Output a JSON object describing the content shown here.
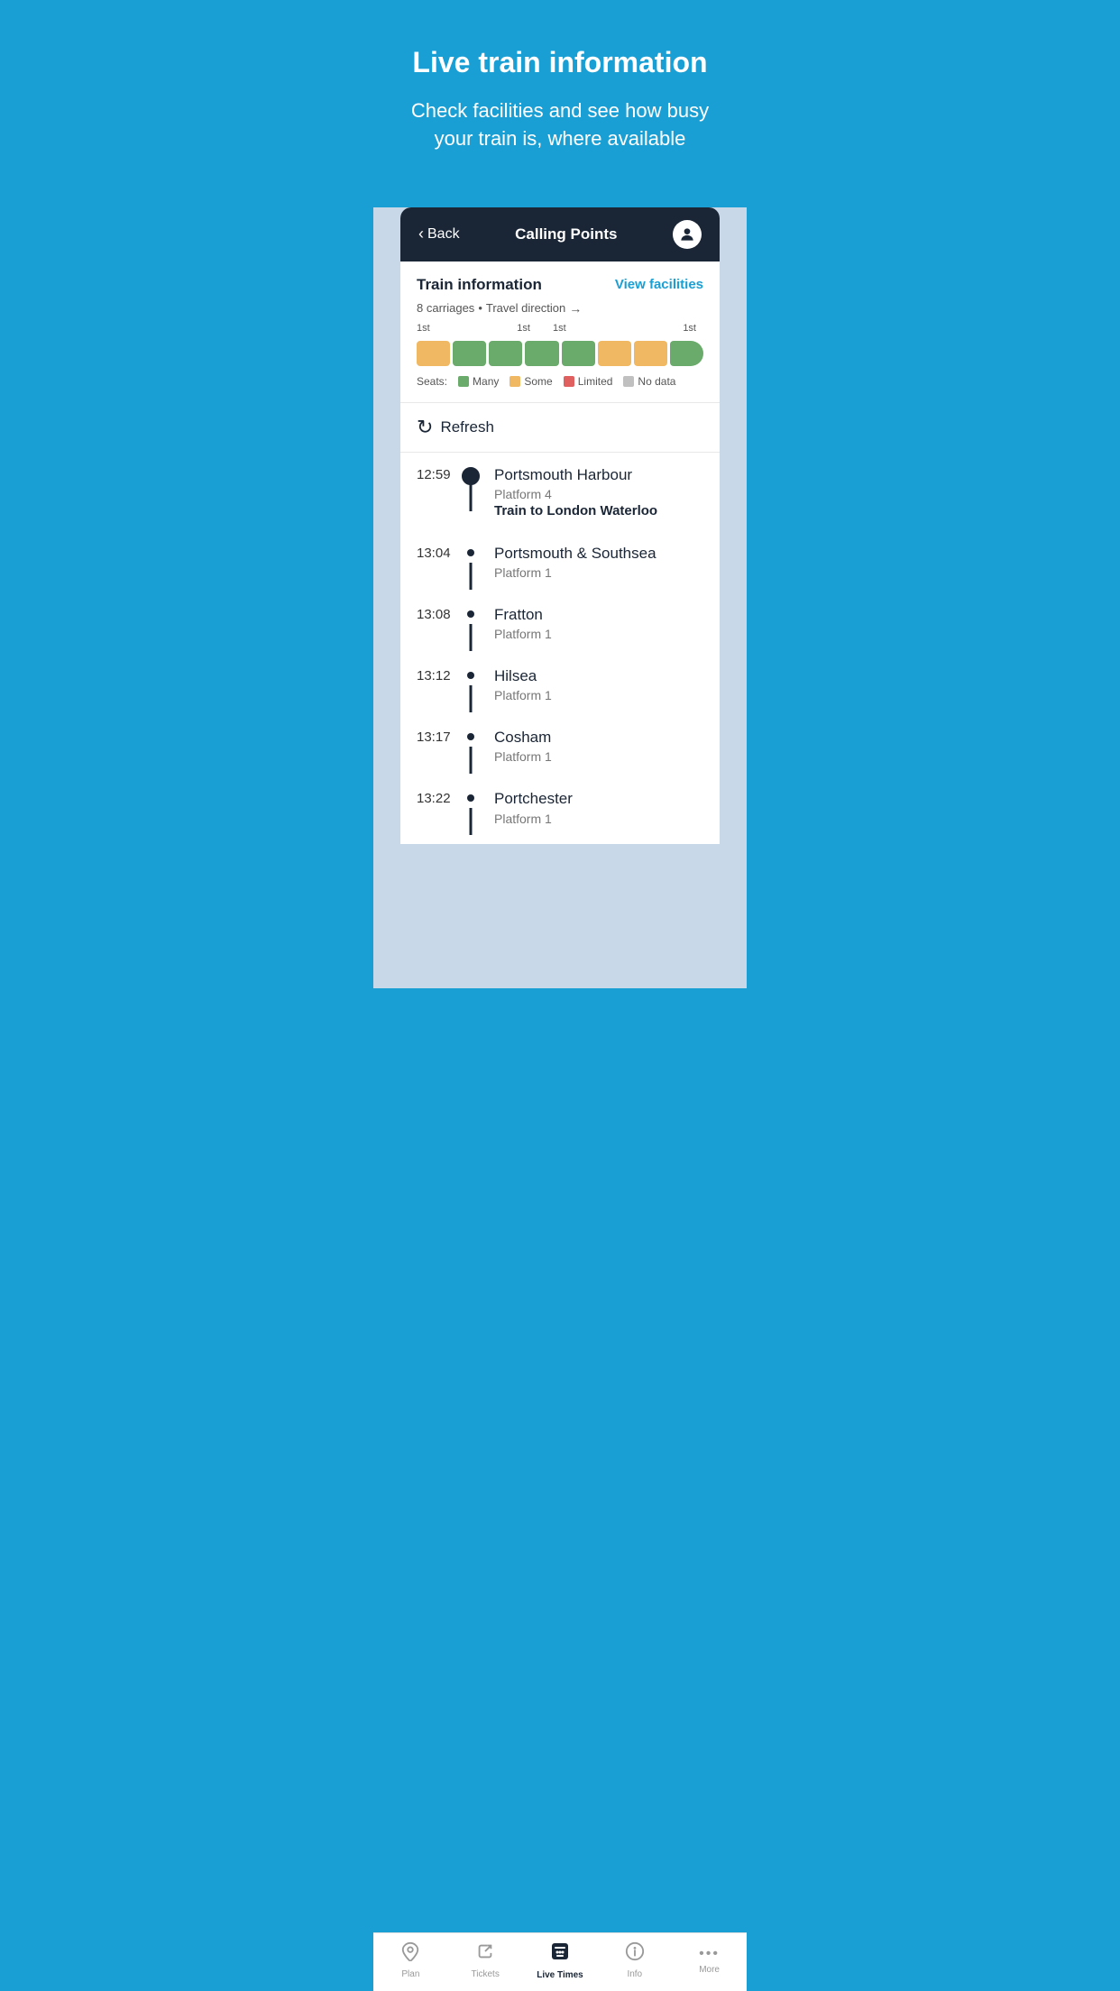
{
  "hero": {
    "title": "Live train information",
    "subtitle": "Check facilities and see how busy your train is, where available"
  },
  "navbar": {
    "back_label": "Back",
    "title": "Calling Points"
  },
  "train_info": {
    "title": "Train information",
    "view_facilities": "View facilities",
    "carriages_info": "8 carriages",
    "travel_direction": "Travel direction",
    "carriages": [
      {
        "type": "orange"
      },
      {
        "type": "green"
      },
      {
        "type": "green"
      },
      {
        "type": "green"
      },
      {
        "type": "green"
      },
      {
        "type": "orange"
      },
      {
        "type": "orange"
      },
      {
        "type": "green",
        "last": true
      }
    ],
    "carriage_labels": [
      {
        "text": "1st",
        "pos": 0
      },
      {
        "text": "1st",
        "pos": 3
      },
      {
        "text": "1st",
        "pos": 4
      },
      {
        "text": "1st",
        "pos": 7
      }
    ],
    "seats_label": "Seats:",
    "legend": [
      {
        "label": "Many",
        "color": "green"
      },
      {
        "label": "Some",
        "color": "orange"
      },
      {
        "label": "Limited",
        "color": "red"
      },
      {
        "label": "No data",
        "color": "gray"
      }
    ]
  },
  "refresh": {
    "label": "Refresh"
  },
  "stops": [
    {
      "time": "12:59",
      "name": "Portsmouth Harbour",
      "platform": "Platform 4",
      "destination": "Train to London Waterloo",
      "is_first": true
    },
    {
      "time": "13:04",
      "name": "Portsmouth & Southsea",
      "platform": "Platform 1",
      "destination": null,
      "is_first": false
    },
    {
      "time": "13:08",
      "name": "Fratton",
      "platform": "Platform 1",
      "destination": null,
      "is_first": false
    },
    {
      "time": "13:12",
      "name": "Hilsea",
      "platform": "Platform 1",
      "destination": null,
      "is_first": false
    },
    {
      "time": "13:17",
      "name": "Cosham",
      "platform": "Platform 1",
      "destination": null,
      "is_first": false
    },
    {
      "time": "13:22",
      "name": "Portchester",
      "platform": "Platform 1",
      "destination": null,
      "is_first": false
    }
  ],
  "tabs": [
    {
      "label": "Plan",
      "icon": "📍",
      "active": false
    },
    {
      "label": "Tickets",
      "icon": "🎫",
      "active": false
    },
    {
      "label": "Live Times",
      "icon": "🚇",
      "active": true
    },
    {
      "label": "Info",
      "icon": "ℹ️",
      "active": false
    },
    {
      "label": "More",
      "icon": "···",
      "active": false
    }
  ]
}
